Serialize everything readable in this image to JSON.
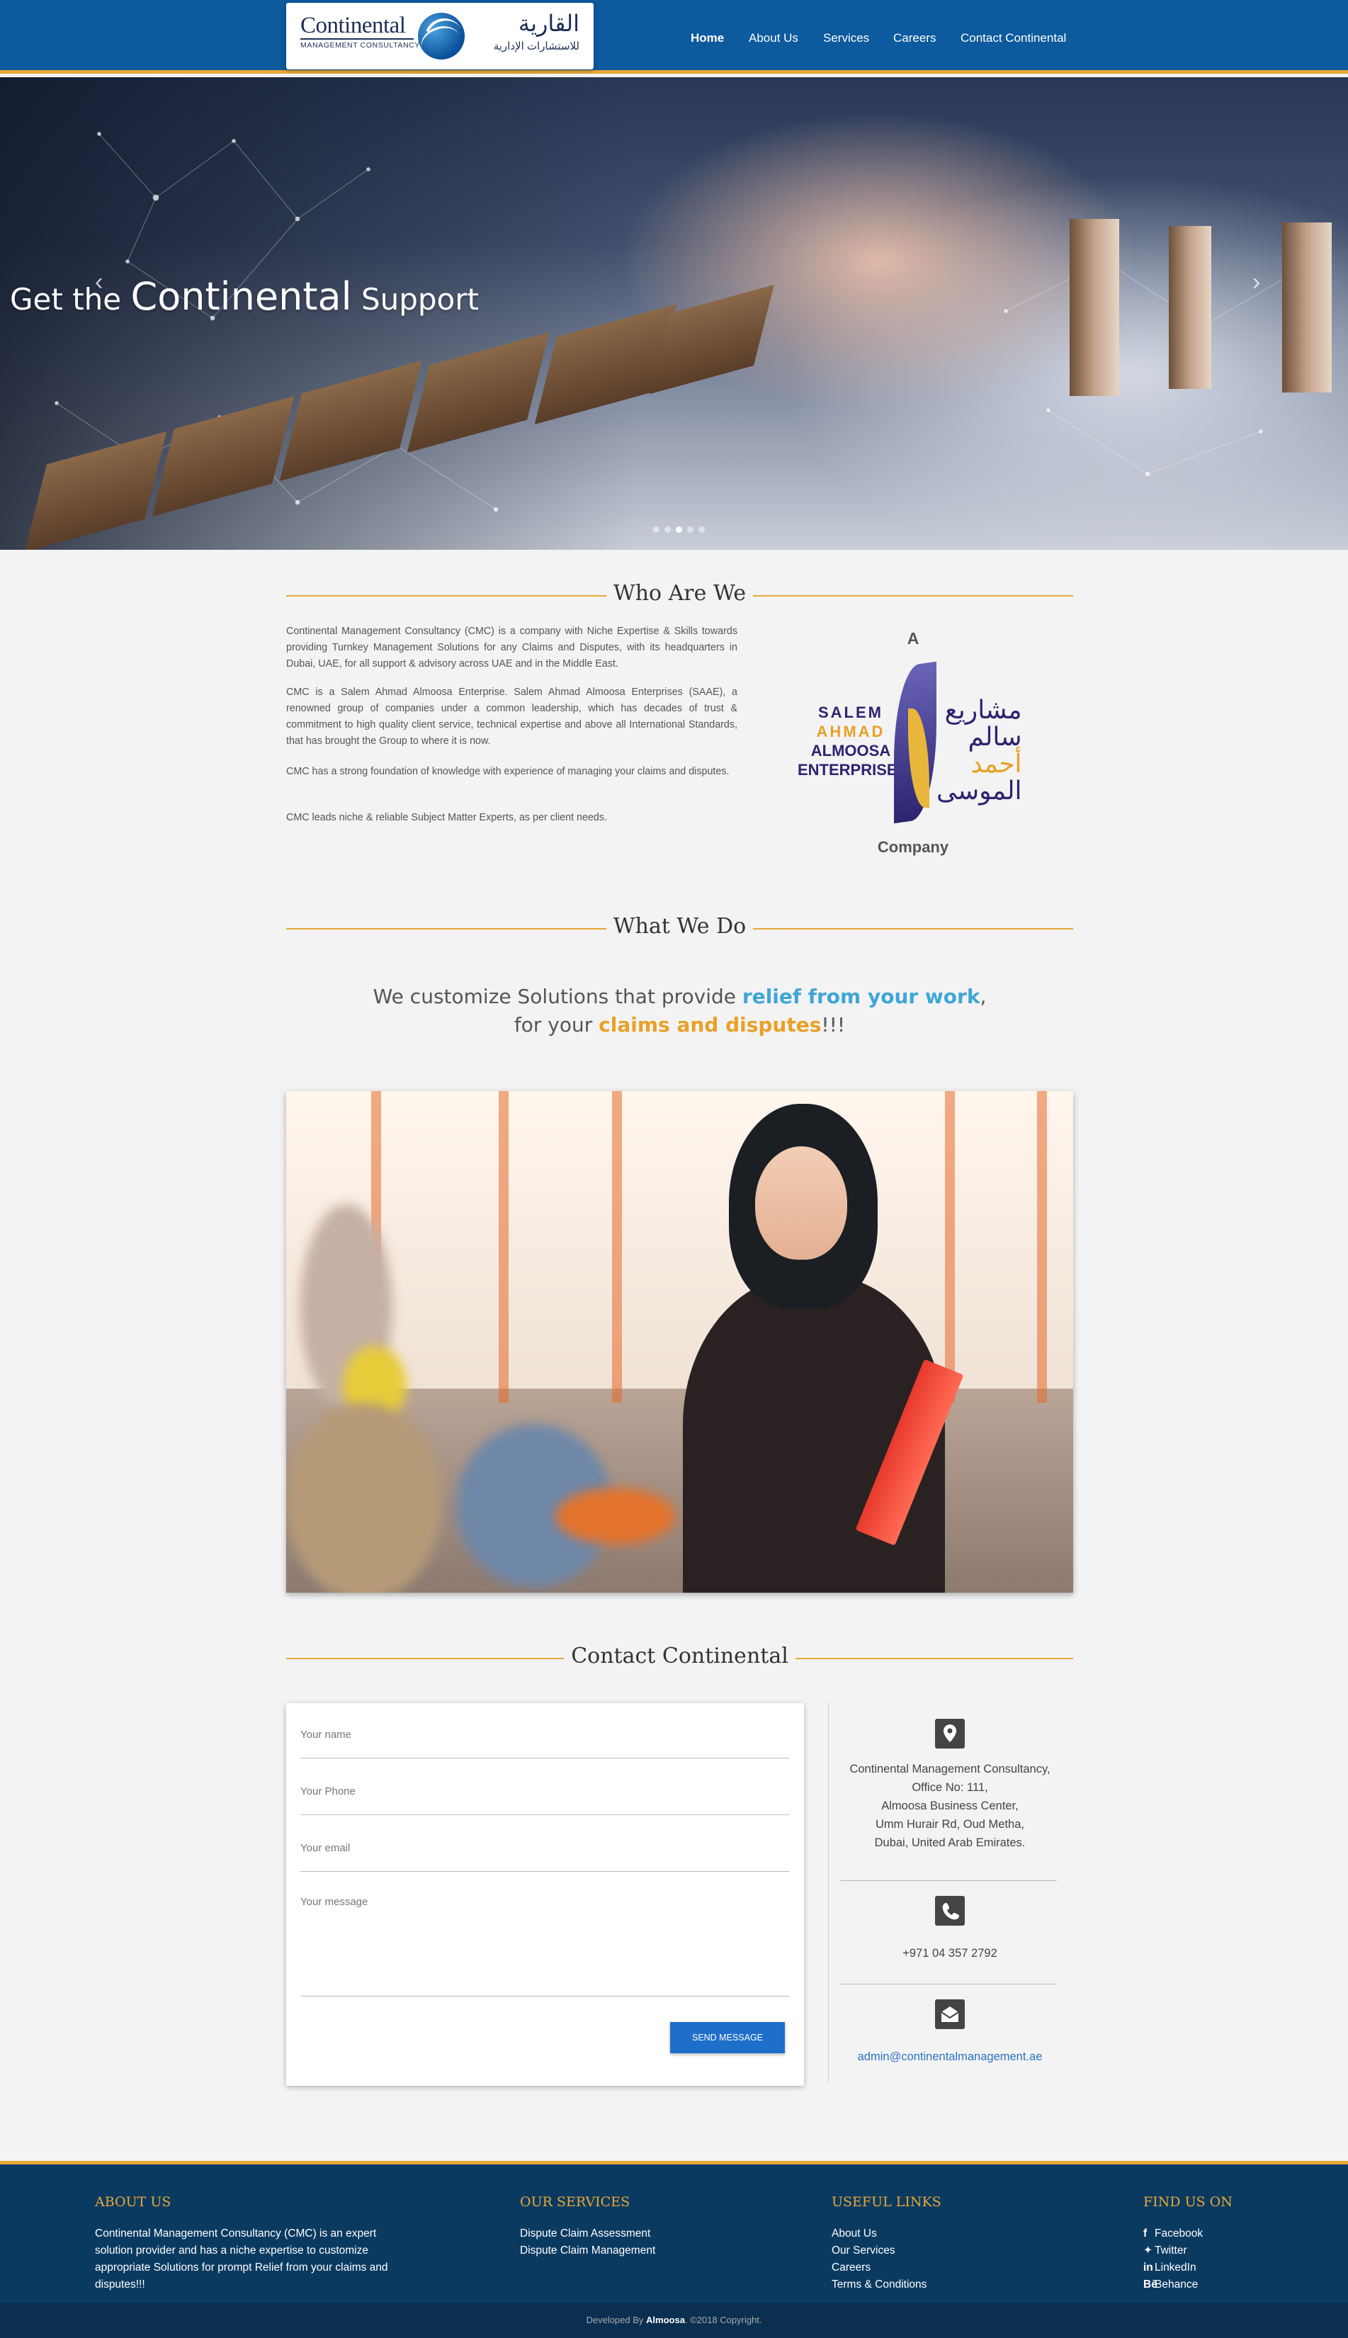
{
  "header": {
    "logo": {
      "en_name": "Continental",
      "en_sub": "MANAGEMENT CONSULTANCY",
      "ar_name": "القارية",
      "ar_sub": "للاستشارات الإدارية"
    },
    "nav": [
      {
        "label": "Home",
        "active": true
      },
      {
        "label": "About Us",
        "active": false
      },
      {
        "label": "Services",
        "active": false
      },
      {
        "label": "Careers",
        "active": false
      },
      {
        "label": "Contact Continental",
        "active": false
      }
    ]
  },
  "hero": {
    "title_part1": "Get the",
    "title_big": "Continental",
    "title_part2": "Support",
    "prev_icon": "chevron-left-icon",
    "next_icon": "chevron-right-icon",
    "slides": 5,
    "active_slide": 3
  },
  "who_are_we": {
    "title": "Who Are We",
    "paragraphs": [
      "Continental Management Consultancy (CMC) is a company with Niche Expertise & Skills towards providing Turnkey Management Solutions for any Claims and Disputes, with its headquarters in Dubai, UAE, for all support & advisory across UAE and in the Middle East.",
      "CMC is a Salem Ahmad Almoosa Enterprise. Salem Ahmad Almoosa Enterprises (SAAE), a renowned group of companies under a common leadership, which has decades of trust & commitment to high quality client service, technical expertise and above all International Standards, that has brought the Group to where it is now.",
      "CMC has a strong foundation of knowledge with experience of managing your claims and disputes.",
      "CMC leads niche & reliable Subject Matter Experts, as per client needs."
    ],
    "saae": {
      "top": "A",
      "bottom": "Company",
      "en_lines": [
        "SALEM",
        "AHMAD",
        "ALMOOSA",
        "ENTERPRISES"
      ],
      "ar_lines": [
        "مشاريع",
        "سالم",
        "أحمد",
        "الموسى"
      ]
    }
  },
  "what_we_do": {
    "title": "What We Do",
    "line1_pre": "We customize Solutions that provide ",
    "line1_hl": "relief from your work",
    "line1_post": ",",
    "line2_pre": "for your ",
    "line2_hl": "claims and disputes",
    "line2_post": "!!!"
  },
  "contact": {
    "title": "Contact Continental",
    "form": {
      "name_placeholder": "Your name",
      "phone_placeholder": "Your Phone",
      "email_placeholder": "Your email",
      "message_placeholder": "Your message",
      "send_label": "SEND MESSAGE"
    },
    "address_icon": "map-marker-icon",
    "address_lines": [
      "Continental Management Consultancy,",
      "Office No: 111,",
      "Almoosa Business Center,",
      "Umm Hurair Rd, Oud Metha,",
      "Dubai, United Arab Emirates."
    ],
    "phone_icon": "phone-icon",
    "phone": "+971 04 357 2792",
    "email_icon": "envelope-icon",
    "email": "admin@continentalmanagement.ae"
  },
  "footer": {
    "about": {
      "title": "ABOUT US",
      "text": "Continental Management Consultancy (CMC) is an expert solution provider and has a niche expertise to customize appropriate Solutions for prompt Relief from your claims and disputes!!!"
    },
    "services": {
      "title": "OUR SERVICES",
      "links": [
        "Dispute Claim Assessment",
        "Dispute Claim Management"
      ]
    },
    "useful": {
      "title": "USEFUL LINKS",
      "links": [
        "About Us",
        "Our Services",
        "Careers",
        "Terms & Conditions"
      ]
    },
    "social": {
      "title": "FIND US ON",
      "links": [
        {
          "label": "Facebook",
          "glyph": "f"
        },
        {
          "label": "Twitter",
          "glyph": "✦"
        },
        {
          "label": "LinkedIn",
          "glyph": "in"
        },
        {
          "label": "Behance",
          "glyph": "Bē"
        }
      ]
    },
    "copyright_pre": "Developed By ",
    "copyright_brand": "Almoosa",
    "copyright_post": ". ©2018 Copyright."
  },
  "colors": {
    "brand_blue": "#0d5a9e",
    "accent_gold": "#e8a836",
    "footer_navy": "#0b3a61",
    "highlight_blue": "#3fa6d6",
    "highlight_orange": "#e8a128",
    "button_blue": "#1e6fc9"
  }
}
